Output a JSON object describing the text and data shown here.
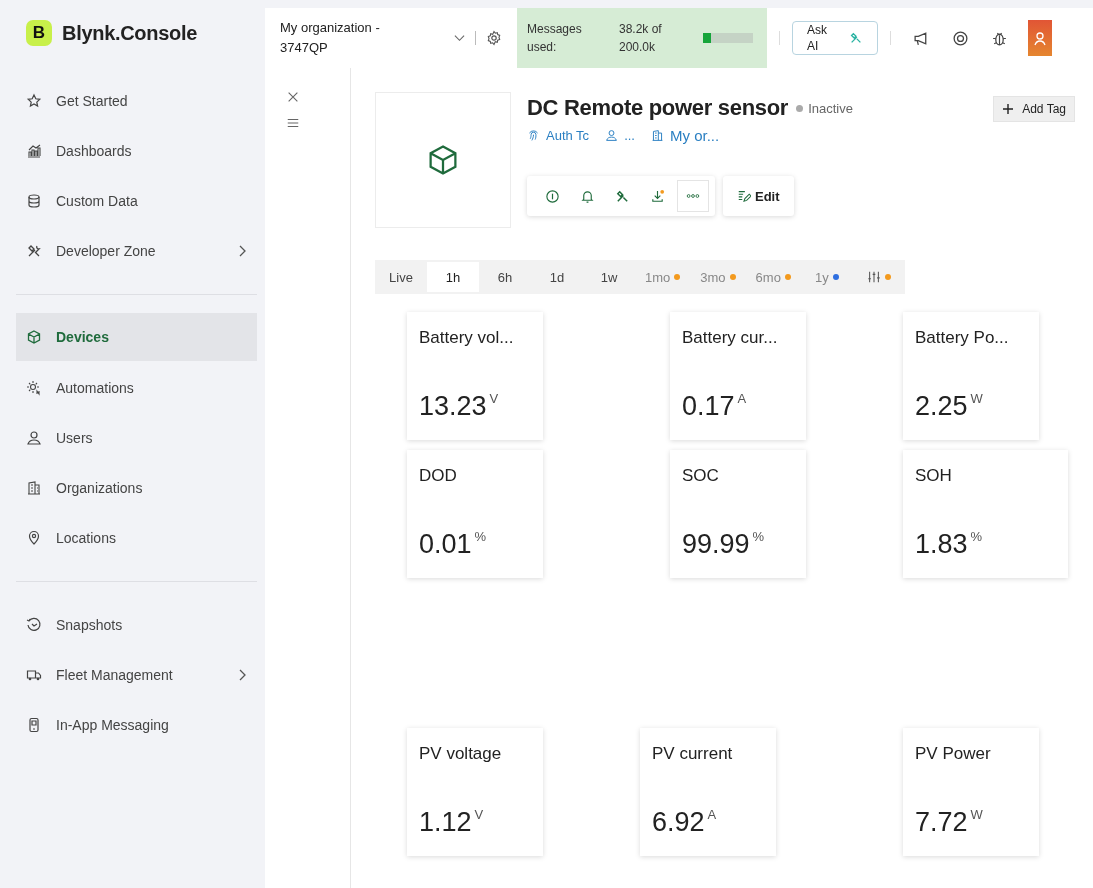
{
  "brand": {
    "badge": "B",
    "name": "Blynk.Console"
  },
  "header": {
    "organization": "My organization - 3747QP",
    "messages_label": "Messages used:",
    "messages_value": "38.2k of 200.0k",
    "level": 0.1,
    "ask_ai": "Ask AI"
  },
  "sidebar": {
    "groups": [
      [
        {
          "label": "Get Started",
          "selected": false,
          "expandable": false
        },
        {
          "label": "Dashboards",
          "selected": false,
          "expandable": false
        },
        {
          "label": "Custom Data",
          "selected": false,
          "expandable": false
        },
        {
          "label": "Developer Zone",
          "selected": false,
          "expandable": true
        }
      ],
      [
        {
          "label": "Devices",
          "selected": true,
          "expandable": false
        },
        {
          "label": "Automations",
          "selected": false,
          "expandable": false
        },
        {
          "label": "Users",
          "selected": false,
          "expandable": false
        },
        {
          "label": "Organizations",
          "selected": false,
          "expandable": false
        },
        {
          "label": "Locations",
          "selected": false,
          "expandable": false
        }
      ],
      [
        {
          "label": "Snapshots",
          "selected": false,
          "expandable": false
        },
        {
          "label": "Fleet Management",
          "selected": false,
          "expandable": true
        },
        {
          "label": "In-App Messaging",
          "selected": false,
          "expandable": false
        }
      ]
    ]
  },
  "device": {
    "name": "DC Remote power sensor",
    "status": "Inactive",
    "online": false,
    "auth": "Auth Tc",
    "owner": "...",
    "org": "My or...",
    "add_tag": "Add Tag",
    "edit": "Edit"
  },
  "time_tabs": [
    {
      "label": "Live",
      "selected": false
    },
    {
      "label": "1h",
      "selected": true
    },
    {
      "label": "6h",
      "selected": false
    },
    {
      "label": "1d",
      "selected": false
    },
    {
      "label": "1w",
      "selected": false
    },
    {
      "label": "1mo",
      "selected": false,
      "color": "#f39a1e"
    },
    {
      "label": "3mo",
      "selected": false,
      "color": "#f39a1e"
    },
    {
      "label": "6mo",
      "selected": false,
      "color": "#f39a1e"
    },
    {
      "label": "1y",
      "selected": false,
      "color": "#2f6fe0"
    },
    {
      "kind": "filter",
      "selected": false,
      "color": "#f39a1e"
    }
  ],
  "widget_rows": [
    [
      {
        "title": "Battery vol...",
        "value": "13.23",
        "unit": "V"
      },
      {
        "title": "Battery cur...",
        "value": "0.17",
        "unit": "A"
      },
      {
        "title": "Battery Po...",
        "value": "2.25",
        "unit": "W"
      }
    ],
    [
      {
        "title": "DOD",
        "value": "0.01",
        "unit": "%"
      },
      {
        "title": "SOC",
        "value": "99.99",
        "unit": "%"
      },
      {
        "title": "SOH",
        "value": "1.83",
        "unit": "%"
      }
    ],
    [
      {
        "title": "PV voltage",
        "value": "1.12",
        "unit": "V"
      },
      {
        "title": "PV current",
        "value": "6.92",
        "unit": "A"
      },
      {
        "title": "PV Power",
        "value": "7.72",
        "unit": "W"
      }
    ]
  ]
}
